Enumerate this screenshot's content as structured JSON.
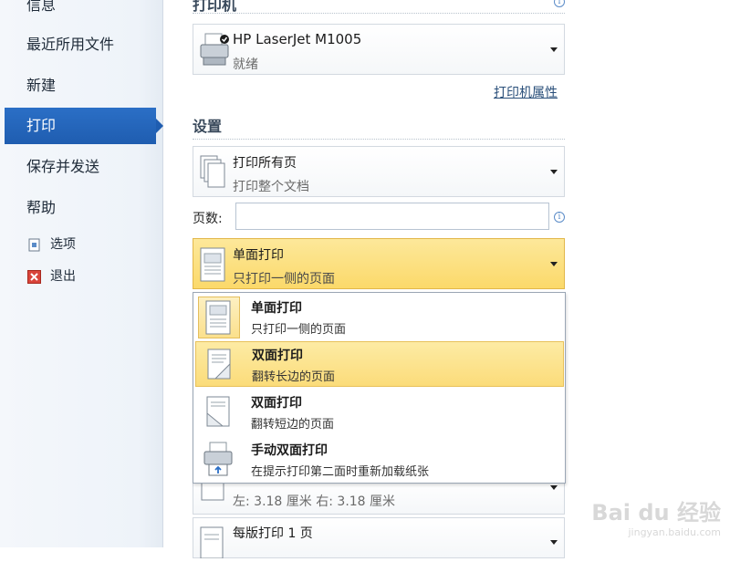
{
  "nav": {
    "info": "信息",
    "recent": "最近所用文件",
    "new": "新建",
    "print": "打印",
    "save_send": "保存并发送",
    "help": "帮助",
    "options": "选项",
    "exit": "退出"
  },
  "printer": {
    "section": "打印机",
    "name": "HP LaserJet M1005",
    "status": "就绪",
    "properties_link": "打印机属性"
  },
  "settings": {
    "section": "设置",
    "print_range_title": "打印所有页",
    "print_range_sub": "打印整个文档",
    "pages_label": "页数:",
    "pages_value": "",
    "duplex_title": "单面打印",
    "duplex_sub": "只打印一侧的页面",
    "margins_text": "左:  3.18 厘米    右:  3.18 厘米",
    "per_sheet_title": "每版打印 1 页"
  },
  "duplex_options": [
    {
      "title": "单面打印",
      "sub": "只打印一侧的页面",
      "icon": "one-sided-page-icon"
    },
    {
      "title": "双面打印",
      "sub": "翻转长边的页面",
      "icon": "duplex-long-edge-icon"
    },
    {
      "title": "双面打印",
      "sub": "翻转短边的页面",
      "icon": "duplex-short-edge-icon"
    },
    {
      "title": "手动双面打印",
      "sub": "在提示打印第二面时重新加载纸张",
      "icon": "manual-duplex-printer-icon"
    }
  ],
  "watermark": {
    "brand": "Bai du 经验",
    "url": "jingyan.baidu.com"
  },
  "colors": {
    "nav_active": "#2b6fc6",
    "highlight": "#fbdc7a"
  }
}
